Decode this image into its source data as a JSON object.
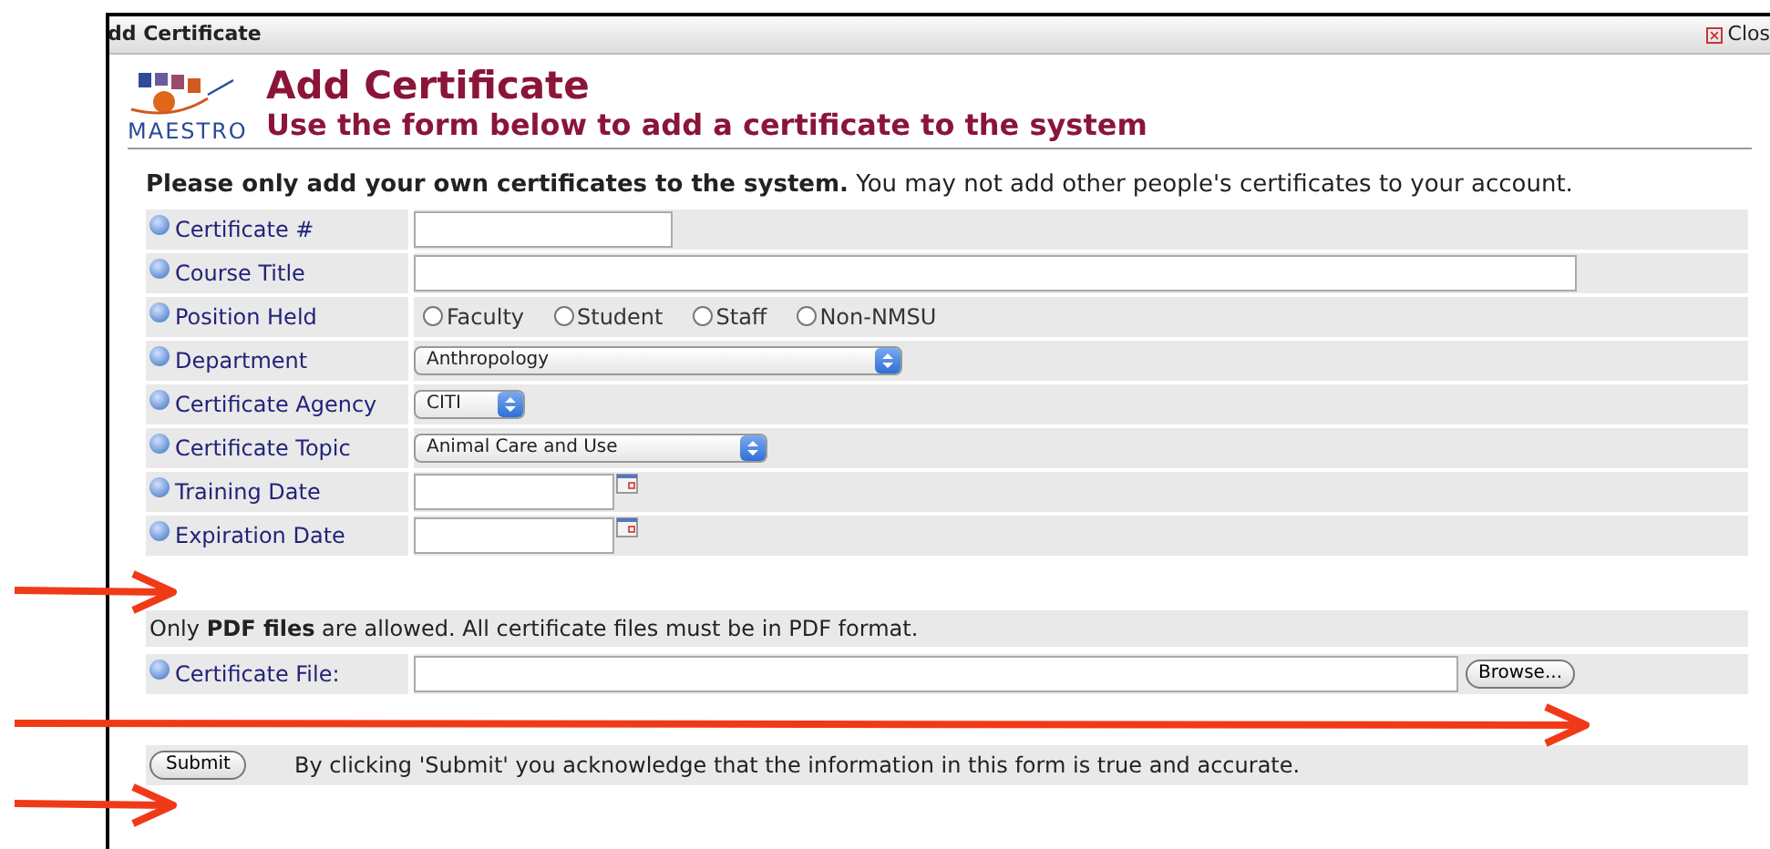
{
  "window": {
    "title": "dd Certificate",
    "close_label": "Clos"
  },
  "header": {
    "logo_text": "MAESTRO",
    "title": "Add Certificate",
    "subtitle": "Use the form below to add a certificate to the system"
  },
  "notice": "**Please only add your own certificates to the system.** You may not add other people's certificates to your account.",
  "fields": [
    {
      "kind": "text-short",
      "label": "Certificate #"
    },
    {
      "kind": "text-wide",
      "label": "Course Title"
    },
    {
      "kind": "radio",
      "label": "Position Held",
      "options": [
        {
          "label": "Faculty",
          "selected": false
        },
        {
          "label": "Student",
          "selected": false
        },
        {
          "label": "Staff",
          "selected": false
        },
        {
          "label": "Non-NMSU",
          "selected": false
        }
      ]
    },
    {
      "kind": "select-wide",
      "label": "Department",
      "value": "Anthropology"
    },
    {
      "kind": "select-short",
      "label": "Certificate Agency",
      "value": "CITI"
    },
    {
      "kind": "select-medium",
      "label": "Certificate Topic",
      "value": "Animal Care and Use"
    },
    {
      "kind": "date",
      "label": "Training Date"
    },
    {
      "kind": "date",
      "label": "Expiration Date"
    }
  ],
  "file_notice": "Only **PDF files** are allowed. All certificate files must be in PDF format.",
  "file_field": {
    "label": "Certificate File:",
    "button": "Browse..."
  },
  "submit": {
    "button": "Submit",
    "note": "By clicking 'Submit' you acknowledge that the information in this form is true and accurate."
  },
  "arrows": [
    {
      "kind": "short"
    },
    {
      "kind": "long"
    },
    {
      "kind": "short"
    }
  ]
}
